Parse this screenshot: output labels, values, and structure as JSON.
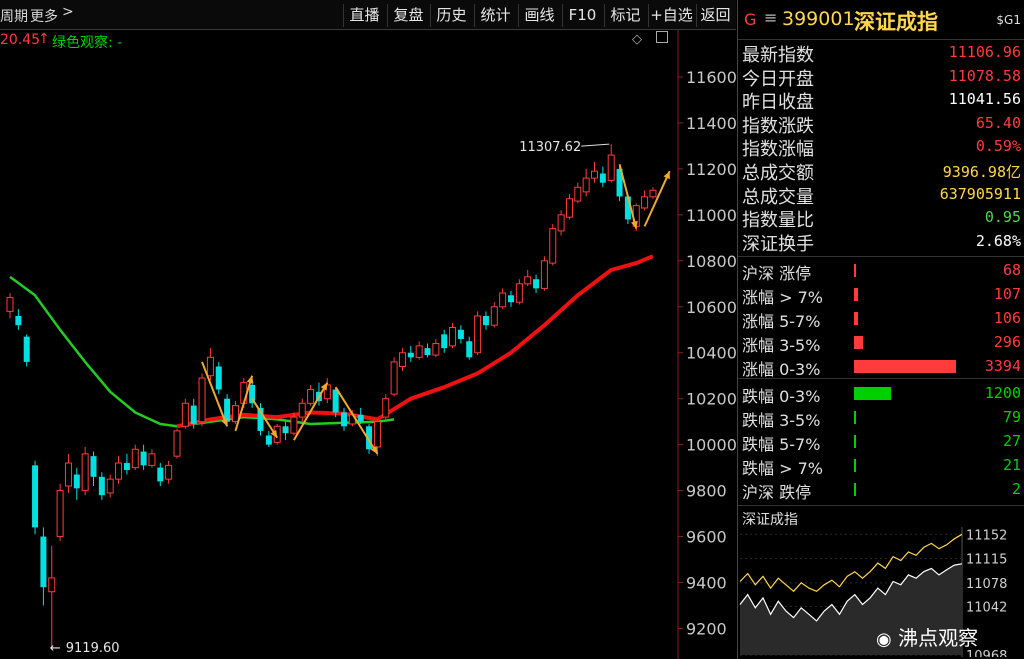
{
  "topbar": {
    "period_label": "周期",
    "more_label": "更多",
    "more_chevron": "chevron-right-icon",
    "buttons": [
      "直播",
      "复盘",
      "历史",
      "统计",
      "画线",
      "F10",
      "标记",
      "+自选",
      "返回"
    ]
  },
  "indicator": {
    "value_label": "20.45",
    "up_arrow": "↑",
    "name": "绿色观察: -"
  },
  "chart_data": {
    "type": "candlestick",
    "ylim": [
      9150,
      11700
    ],
    "yticks": [
      9200,
      9400,
      9600,
      9800,
      10000,
      10200,
      10400,
      10600,
      10800,
      11000,
      11200,
      11400,
      11600
    ],
    "high_annotation": "11307.62",
    "low_annotation": "9119.60",
    "candles": [
      {
        "o": 10580,
        "c": 10640,
        "h": 10660,
        "l": 10550
      },
      {
        "o": 10560,
        "c": 10520,
        "h": 10590,
        "l": 10500
      },
      {
        "o": 10470,
        "c": 10360,
        "h": 10480,
        "l": 10340
      },
      {
        "o": 9910,
        "c": 9640,
        "h": 9930,
        "l": 9610
      },
      {
        "o": 9600,
        "c": 9380,
        "h": 9640,
        "l": 9300
      },
      {
        "o": 9360,
        "c": 9420,
        "h": 9560,
        "l": 9119.6
      },
      {
        "o": 9600,
        "c": 9800,
        "h": 9830,
        "l": 9580
      },
      {
        "o": 9820,
        "c": 9920,
        "h": 9960,
        "l": 9790
      },
      {
        "o": 9870,
        "c": 9810,
        "h": 9900,
        "l": 9760
      },
      {
        "o": 9800,
        "c": 9960,
        "h": 9990,
        "l": 9780
      },
      {
        "o": 9950,
        "c": 9860,
        "h": 9970,
        "l": 9820
      },
      {
        "o": 9860,
        "c": 9780,
        "h": 9880,
        "l": 9760
      },
      {
        "o": 9790,
        "c": 9850,
        "h": 9870,
        "l": 9770
      },
      {
        "o": 9850,
        "c": 9920,
        "h": 9950,
        "l": 9830
      },
      {
        "o": 9920,
        "c": 9890,
        "h": 9960,
        "l": 9870
      },
      {
        "o": 9900,
        "c": 9980,
        "h": 10000,
        "l": 9890
      },
      {
        "o": 9970,
        "c": 9910,
        "h": 10000,
        "l": 9890
      },
      {
        "o": 9910,
        "c": 9960,
        "h": 9980,
        "l": 9900
      },
      {
        "o": 9900,
        "c": 9840,
        "h": 9920,
        "l": 9820
      },
      {
        "o": 9850,
        "c": 9910,
        "h": 9930,
        "l": 9830
      },
      {
        "o": 9950,
        "c": 10060,
        "h": 10070,
        "l": 9940
      },
      {
        "o": 10080,
        "c": 10180,
        "h": 10200,
        "l": 10070
      },
      {
        "o": 10170,
        "c": 10090,
        "h": 10200,
        "l": 10070
      },
      {
        "o": 10100,
        "c": 10290,
        "h": 10310,
        "l": 10080
      },
      {
        "o": 10300,
        "c": 10380,
        "h": 10420,
        "l": 10280
      },
      {
        "o": 10340,
        "c": 10240,
        "h": 10360,
        "l": 10220
      },
      {
        "o": 10200,
        "c": 10100,
        "h": 10220,
        "l": 10080
      },
      {
        "o": 10100,
        "c": 10170,
        "h": 10190,
        "l": 10090
      },
      {
        "o": 10180,
        "c": 10270,
        "h": 10290,
        "l": 10160
      },
      {
        "o": 10260,
        "c": 10180,
        "h": 10280,
        "l": 10160
      },
      {
        "o": 10160,
        "c": 10060,
        "h": 10180,
        "l": 10040
      },
      {
        "o": 10040,
        "c": 10000,
        "h": 10060,
        "l": 9990
      },
      {
        "o": 10010,
        "c": 10080,
        "h": 10090,
        "l": 10000
      },
      {
        "o": 10080,
        "c": 10050,
        "h": 10100,
        "l": 10020
      },
      {
        "o": 10050,
        "c": 10120,
        "h": 10140,
        "l": 10040
      },
      {
        "o": 10120,
        "c": 10180,
        "h": 10200,
        "l": 10100
      },
      {
        "o": 10180,
        "c": 10240,
        "h": 10260,
        "l": 10170
      },
      {
        "o": 10230,
        "c": 10190,
        "h": 10270,
        "l": 10170
      },
      {
        "o": 10200,
        "c": 10260,
        "h": 10290,
        "l": 10180
      },
      {
        "o": 10240,
        "c": 10140,
        "h": 10250,
        "l": 10120
      },
      {
        "o": 10140,
        "c": 10080,
        "h": 10160,
        "l": 10060
      },
      {
        "o": 10090,
        "c": 10130,
        "h": 10150,
        "l": 10080
      },
      {
        "o": 10130,
        "c": 10100,
        "h": 10160,
        "l": 10090
      },
      {
        "o": 10080,
        "c": 9980,
        "h": 10090,
        "l": 9960
      },
      {
        "o": 9990,
        "c": 10100,
        "h": 10110,
        "l": 9950
      },
      {
        "o": 10120,
        "c": 10200,
        "h": 10220,
        "l": 10110
      },
      {
        "o": 10220,
        "c": 10360,
        "h": 10380,
        "l": 10210
      },
      {
        "o": 10340,
        "c": 10400,
        "h": 10420,
        "l": 10320
      },
      {
        "o": 10400,
        "c": 10380,
        "h": 10430,
        "l": 10360
      },
      {
        "o": 10380,
        "c": 10430,
        "h": 10450,
        "l": 10370
      },
      {
        "o": 10420,
        "c": 10390,
        "h": 10440,
        "l": 10380
      },
      {
        "o": 10390,
        "c": 10440,
        "h": 10460,
        "l": 10380
      },
      {
        "o": 10480,
        "c": 10420,
        "h": 10500,
        "l": 10400
      },
      {
        "o": 10430,
        "c": 10510,
        "h": 10530,
        "l": 10420
      },
      {
        "o": 10500,
        "c": 10460,
        "h": 10520,
        "l": 10440
      },
      {
        "o": 10450,
        "c": 10380,
        "h": 10470,
        "l": 10370
      },
      {
        "o": 10400,
        "c": 10560,
        "h": 10580,
        "l": 10390
      },
      {
        "o": 10560,
        "c": 10520,
        "h": 10580,
        "l": 10500
      },
      {
        "o": 10520,
        "c": 10600,
        "h": 10620,
        "l": 10510
      },
      {
        "o": 10600,
        "c": 10660,
        "h": 10680,
        "l": 10590
      },
      {
        "o": 10650,
        "c": 10620,
        "h": 10670,
        "l": 10600
      },
      {
        "o": 10620,
        "c": 10700,
        "h": 10720,
        "l": 10610
      },
      {
        "o": 10700,
        "c": 10730,
        "h": 10760,
        "l": 10690
      },
      {
        "o": 10720,
        "c": 10680,
        "h": 10740,
        "l": 10660
      },
      {
        "o": 10680,
        "c": 10800,
        "h": 10820,
        "l": 10670
      },
      {
        "o": 10790,
        "c": 10940,
        "h": 10960,
        "l": 10780
      },
      {
        "o": 10930,
        "c": 11000,
        "h": 11020,
        "l": 10910
      },
      {
        "o": 10990,
        "c": 11070,
        "h": 11090,
        "l": 10980
      },
      {
        "o": 11060,
        "c": 11120,
        "h": 11140,
        "l": 11050
      },
      {
        "o": 11100,
        "c": 11160,
        "h": 11200,
        "l": 11080
      },
      {
        "o": 11160,
        "c": 11190,
        "h": 11230,
        "l": 11140
      },
      {
        "o": 11180,
        "c": 11140,
        "h": 11210,
        "l": 11120
      },
      {
        "o": 11150,
        "c": 11260,
        "h": 11307.62,
        "l": 11140
      },
      {
        "o": 11200,
        "c": 11080,
        "h": 11210,
        "l": 11060
      },
      {
        "o": 11080,
        "c": 10980,
        "h": 11090,
        "l": 10960
      },
      {
        "o": 10950,
        "c": 11040,
        "h": 11050,
        "l": 10930
      },
      {
        "o": 11030,
        "c": 11078.58,
        "h": 11106.96,
        "l": 11020
      },
      {
        "o": 11078.58,
        "c": 11106.96,
        "h": 11120,
        "l": 11070
      }
    ],
    "ma_green": [
      {
        "i": 0,
        "v": 10730
      },
      {
        "i": 3,
        "v": 10650
      },
      {
        "i": 6,
        "v": 10500
      },
      {
        "i": 9,
        "v": 10360
      },
      {
        "i": 12,
        "v": 10230
      },
      {
        "i": 15,
        "v": 10140
      },
      {
        "i": 18,
        "v": 10090
      },
      {
        "i": 20,
        "v": 10080
      },
      {
        "i": 24,
        "v": 10100
      },
      {
        "i": 28,
        "v": 10120
      },
      {
        "i": 32,
        "v": 10110
      },
      {
        "i": 36,
        "v": 10090
      },
      {
        "i": 40,
        "v": 10095
      },
      {
        "i": 44,
        "v": 10100
      },
      {
        "i": 46,
        "v": 10110
      }
    ],
    "ma_red": [
      {
        "i": 20,
        "v": 10080
      },
      {
        "i": 24,
        "v": 10110
      },
      {
        "i": 28,
        "v": 10130
      },
      {
        "i": 32,
        "v": 10120
      },
      {
        "i": 36,
        "v": 10140
      },
      {
        "i": 40,
        "v": 10135
      },
      {
        "i": 44,
        "v": 10110
      },
      {
        "i": 48,
        "v": 10200
      },
      {
        "i": 52,
        "v": 10250
      },
      {
        "i": 56,
        "v": 10310
      },
      {
        "i": 60,
        "v": 10400
      },
      {
        "i": 64,
        "v": 10520
      },
      {
        "i": 68,
        "v": 10650
      },
      {
        "i": 72,
        "v": 10760
      },
      {
        "i": 75,
        "v": 10790
      },
      {
        "i": 77,
        "v": 10820
      }
    ],
    "arrows": [
      {
        "from": {
          "i": 23,
          "v": 10360
        },
        "to": {
          "i": 26,
          "v": 10080
        }
      },
      {
        "from": {
          "i": 27,
          "v": 10060
        },
        "to": {
          "i": 29,
          "v": 10300
        }
      },
      {
        "from": {
          "i": 29,
          "v": 10200
        },
        "to": {
          "i": 32,
          "v": 10030
        }
      },
      {
        "from": {
          "i": 34,
          "v": 10020
        },
        "to": {
          "i": 38,
          "v": 10270
        }
      },
      {
        "from": {
          "i": 39,
          "v": 10250
        },
        "to": {
          "i": 44,
          "v": 9960
        }
      },
      {
        "from": {
          "i": 73,
          "v": 11220
        },
        "to": {
          "i": 75,
          "v": 10940
        }
      },
      {
        "from": {
          "i": 76,
          "v": 10950
        },
        "to": {
          "i": 79,
          "v": 11190
        }
      }
    ]
  },
  "panel": {
    "grade": "G",
    "menu_icon": "menu-icon",
    "code": "399001",
    "name": "深证成指",
    "tag": "$G1",
    "quotes": [
      {
        "k": "最新指数",
        "v": "11106.96",
        "color": "#ff3b3b"
      },
      {
        "k": "今日开盘",
        "v": "11078.58",
        "color": "#ff3b3b"
      },
      {
        "k": "昨日收盘",
        "v": "11041.56",
        "color": "#ffffff"
      },
      {
        "k": "指数涨跌",
        "v": "65.40",
        "color": "#ff3b3b"
      },
      {
        "k": "指数涨幅",
        "v": "0.59%",
        "color": "#ff3b3b"
      },
      {
        "k": "总成交额",
        "v": "9396.98亿",
        "color": "#ffd84a"
      },
      {
        "k": "总成交量",
        "v": "637905911",
        "color": "#ffd84a"
      },
      {
        "k": "指数量比",
        "v": "0.95",
        "color": "#4cd94c"
      },
      {
        "k": "深证换手",
        "v": "2.68%",
        "color": "#ffffff"
      }
    ],
    "breadth_up": [
      {
        "k": "沪深 涨停",
        "v": "68",
        "bar": 0.01
      },
      {
        "k": "涨幅 > 7%",
        "v": "107",
        "bar": 0.04
      },
      {
        "k": "涨幅 5-7%",
        "v": "106",
        "bar": 0.04
      },
      {
        "k": "涨幅 3-5%",
        "v": "296",
        "bar": 0.09
      },
      {
        "k": "涨幅 0-3%",
        "v": "3394",
        "bar": 1.0
      }
    ],
    "breadth_down": [
      {
        "k": "跌幅 0-3%",
        "v": "1200",
        "bar": 0.36
      },
      {
        "k": "跌幅 3-5%",
        "v": "79",
        "bar": 0.01
      },
      {
        "k": "跌幅 5-7%",
        "v": "27",
        "bar": 0.01
      },
      {
        "k": "跌幅 > 7%",
        "v": "21",
        "bar": 0.01
      },
      {
        "k": "沪深 跌停",
        "v": "2",
        "bar": 0.01
      }
    ],
    "colors": {
      "up": "#ff3b3b",
      "down": "#00d000",
      "label": "#e0e0e0"
    }
  },
  "mini": {
    "title": "深证成指",
    "yticks": [
      "11152",
      "11115",
      "11078",
      "11042",
      "10968"
    ],
    "series_white": [
      11045,
      11060,
      11040,
      11055,
      11030,
      11050,
      11035,
      11025,
      11040,
      11030,
      11020,
      11035,
      11045,
      11030,
      11050,
      11060,
      11045,
      11055,
      11070,
      11060,
      11080,
      11075,
      11090,
      11085,
      11095,
      11100,
      11090,
      11098,
      11105,
      11107
    ],
    "series_yellow": [
      11080,
      11092,
      11075,
      11088,
      11070,
      11085,
      11075,
      11065,
      11078,
      11070,
      11065,
      11075,
      11082,
      11072,
      11088,
      11095,
      11085,
      11095,
      11108,
      11100,
      11118,
      11112,
      11125,
      11120,
      11132,
      11138,
      11130,
      11136,
      11145,
      11152
    ]
  },
  "watermark": "沸点观察",
  "watermark_icon": "weibo-icon"
}
